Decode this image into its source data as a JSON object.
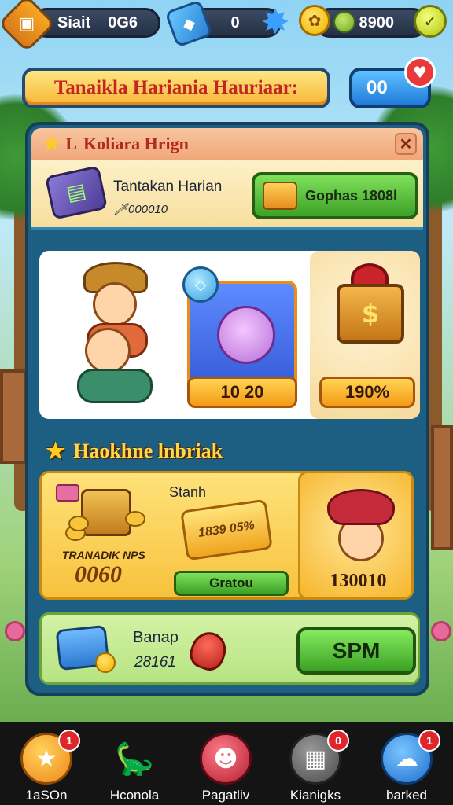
{
  "topbar": {
    "profile": {
      "label": "Siait",
      "value": "0G6"
    },
    "gems": {
      "value": "0"
    },
    "coins": {
      "value": "8900"
    }
  },
  "banner": {
    "title": "Tanaikla Hariania Hauriaar:",
    "counter": "00",
    "heart": "♥"
  },
  "panel": {
    "header": {
      "letter": "L",
      "title": "Koliara Hrign",
      "close": "✕"
    },
    "daily": {
      "title": "Tantakan Harian",
      "subtitle": "🗡000010",
      "button_label": "Gophas 1808l"
    },
    "featured": {
      "bear_price": "10 20",
      "money_price": "190%"
    },
    "section2": {
      "title": "Haokhne lnbriak"
    },
    "offers": {
      "chest_label": "TRANADIK NPS",
      "chest_value": "0060",
      "stash_label": "Stanh",
      "ticket_text": "1839 05%",
      "gratis_label": "Gratou",
      "hat_value": "130010"
    },
    "bottom": {
      "title": "Banap",
      "value": "28161",
      "button_label": "SPM"
    }
  },
  "nav": {
    "items": [
      {
        "label": "1aSOn",
        "badge": "1",
        "icon": "star-icon",
        "color": "#f4a21a"
      },
      {
        "label": "Hconola",
        "badge": "",
        "icon": "dino-icon",
        "color": "#3aa33a"
      },
      {
        "label": "Pagatliv",
        "badge": "1",
        "icon": "character-icon",
        "color": "#c82a3a"
      },
      {
        "label": "Kianigks",
        "badge": "0",
        "icon": "cards-icon",
        "color": "#6a6a6a"
      },
      {
        "label": "barked",
        "badge": "1",
        "icon": "pet-icon",
        "color": "#2f7fd8"
      }
    ]
  }
}
